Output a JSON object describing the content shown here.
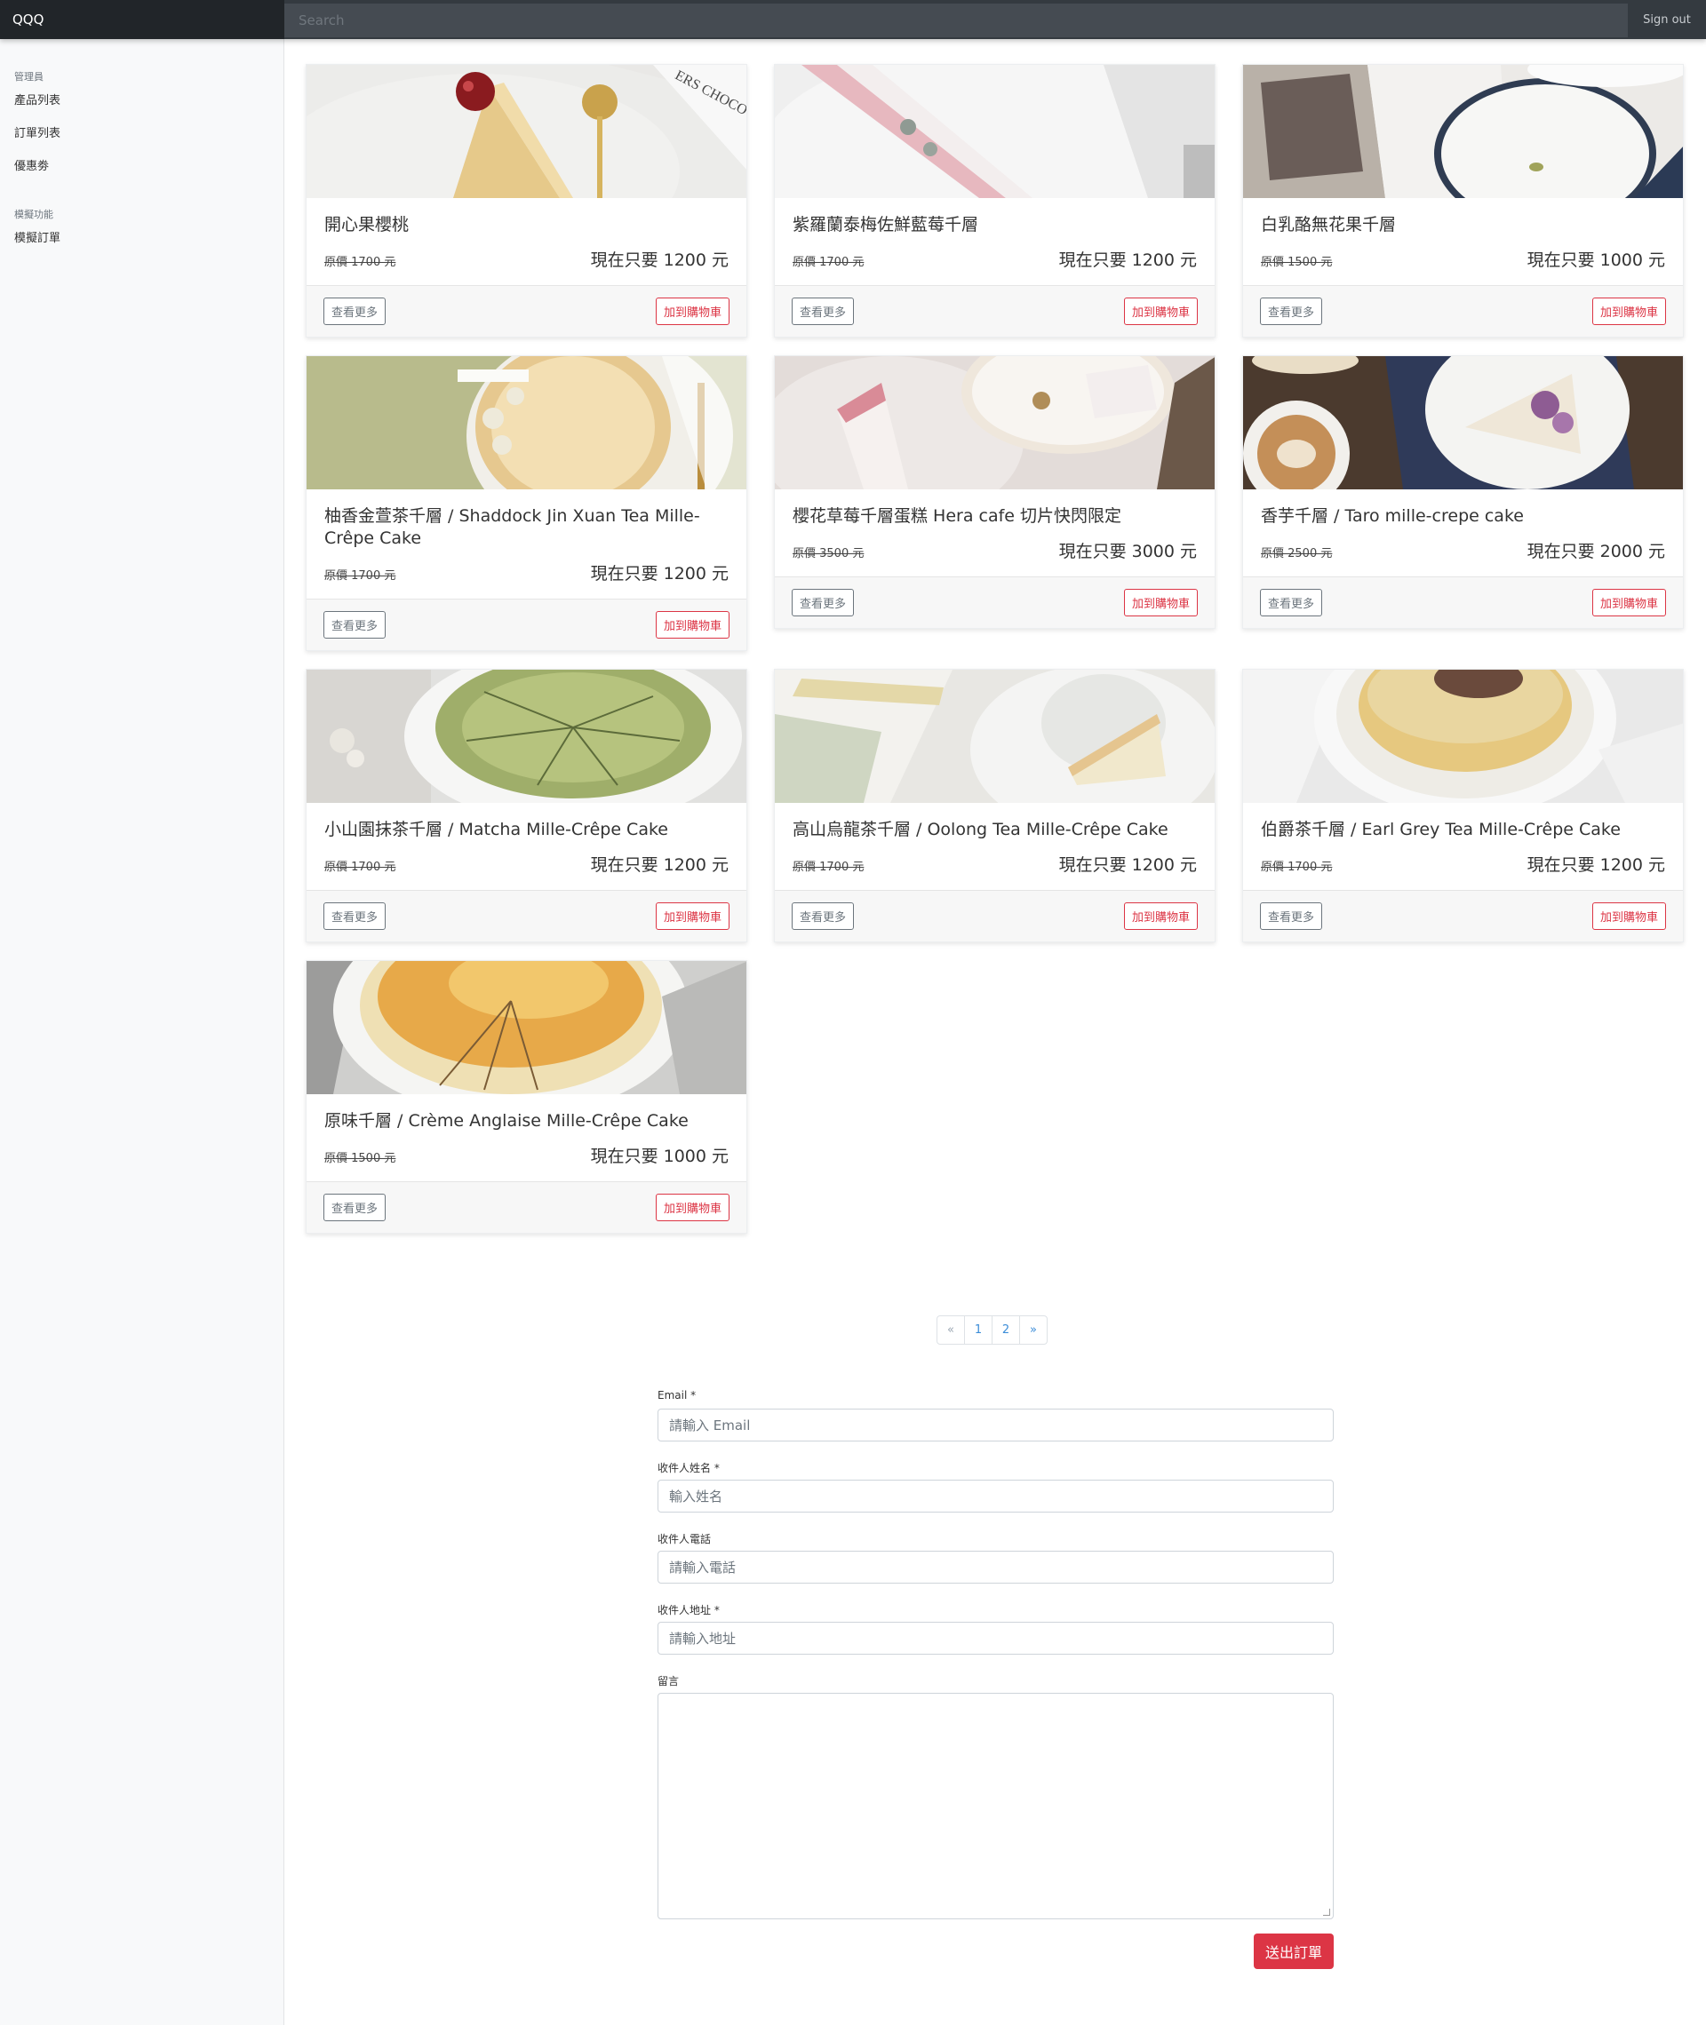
{
  "navbar": {
    "brand": "QQQ",
    "search_placeholder": "Search",
    "sign_out": "Sign out"
  },
  "sidebar": {
    "section1_heading": "管理員",
    "section1_items": [
      "產品列表",
      "訂單列表",
      "優惠劵"
    ],
    "section2_heading": "模擬功能",
    "section2_items": [
      "模擬訂單"
    ]
  },
  "buttons": {
    "more": "查看更多",
    "cart": "加到購物車"
  },
  "products": [
    {
      "title": "開心果櫻桃",
      "original": "原價 1700 元",
      "now": "現在只要 1200 元"
    },
    {
      "title": "紫羅蘭泰梅佐鮮藍莓千層",
      "original": "原價 1700 元",
      "now": "現在只要 1200 元"
    },
    {
      "title": "白乳酪無花果千層",
      "original": "原價 1500 元",
      "now": "現在只要 1000 元"
    },
    {
      "title": "柚香金萱茶千層 / Shaddock Jin Xuan Tea Mille-Crêpe Cake",
      "original": "原價 1700 元",
      "now": "現在只要 1200 元"
    },
    {
      "title": "櫻花草莓千層蛋糕 Hera cafe 切片快閃限定",
      "original": "原價 3500 元",
      "now": "現在只要 3000 元"
    },
    {
      "title": "香芋千層 / Taro mille-crepe cake",
      "original": "原價 2500 元",
      "now": "現在只要 2000 元"
    },
    {
      "title": "小山園抹茶千層 / Matcha Mille-Crêpe Cake",
      "original": "原價 1700 元",
      "now": "現在只要 1200 元"
    },
    {
      "title": "高山烏龍茶千層 / Oolong Tea Mille-Crêpe Cake",
      "original": "原價 1700 元",
      "now": "現在只要 1200 元"
    },
    {
      "title": "伯爵茶千層 / Earl Grey Tea Mille-Crêpe Cake",
      "original": "原價 1700 元",
      "now": "現在只要 1200 元"
    },
    {
      "title": "原味千層 / Crème Anglaise Mille-Crêpe Cake",
      "original": "原價 1500 元",
      "now": "現在只要 1000 元"
    }
  ],
  "pagination": {
    "prev": "«",
    "pages": [
      "1",
      "2"
    ],
    "next": "»"
  },
  "form": {
    "email_label": "Email *",
    "email_placeholder": "請輸入 Email",
    "name_label": "收件人姓名 *",
    "name_placeholder": "輸入姓名",
    "phone_label": "收件人電話",
    "phone_placeholder": "請輸入電話",
    "address_label": "收件人地址 *",
    "address_placeholder": "請輸入地址",
    "message_label": "留言",
    "submit": "送出訂單"
  }
}
